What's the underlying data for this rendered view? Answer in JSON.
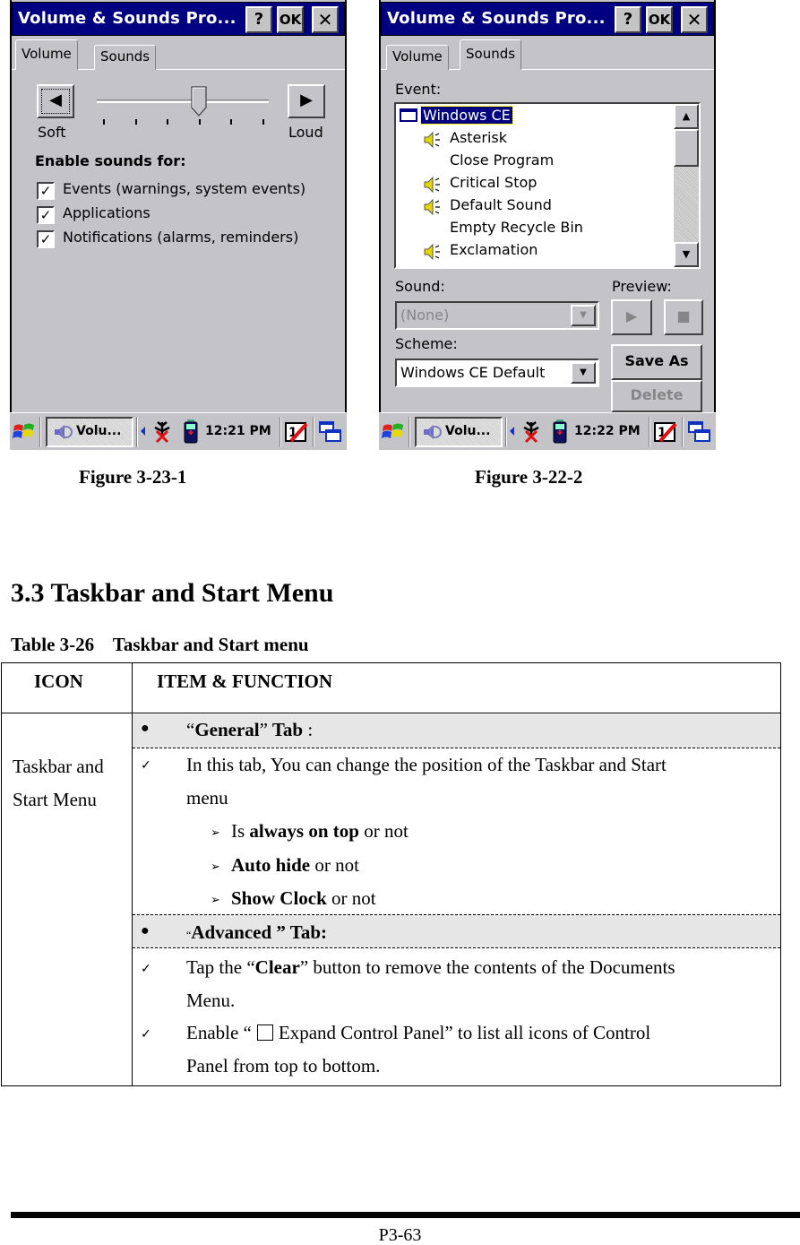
{
  "screenshots": {
    "volume": {
      "window_title": "Volume & Sounds Pro...",
      "title_buttons": {
        "help": "?",
        "ok": "OK",
        "close": "✕"
      },
      "tabs": [
        {
          "label": "Volume",
          "active": true
        },
        {
          "label": "Sounds",
          "active": false
        }
      ],
      "slider": {
        "min_label": "Soft",
        "max_label": "Loud",
        "value_fraction": 0.6,
        "tick_count": 6
      },
      "enable_heading": "Enable sounds for:",
      "checkboxes": [
        {
          "label": "Events (warnings, system events)",
          "checked": true
        },
        {
          "label": "Applications",
          "checked": true
        },
        {
          "label": "Notifications (alarms, reminders)",
          "checked": true
        }
      ],
      "taskbar": {
        "task_label": "Volu...",
        "clock": "12:21 PM",
        "input_indicator": "1"
      }
    },
    "sounds": {
      "window_title": "Volume & Sounds Pro...",
      "title_buttons": {
        "help": "?",
        "ok": "OK",
        "close": "✕"
      },
      "tabs": [
        {
          "label": "Volume",
          "active": false
        },
        {
          "label": "Sounds",
          "active": true
        }
      ],
      "event_label": "Event:",
      "event_root": "Windows CE",
      "events": [
        {
          "label": "Asterisk",
          "has_sound": true
        },
        {
          "label": "Close Program",
          "has_sound": false
        },
        {
          "label": "Critical Stop",
          "has_sound": true
        },
        {
          "label": "Default Sound",
          "has_sound": true
        },
        {
          "label": "Empty Recycle Bin",
          "has_sound": false
        },
        {
          "label": "Exclamation",
          "has_sound": true
        }
      ],
      "sound_label": "Sound:",
      "sound_value": "(None)",
      "preview_label": "Preview:",
      "scheme_label": "Scheme:",
      "scheme_value": "Windows CE Default",
      "save_as_label": "Save As",
      "delete_label": "Delete",
      "taskbar": {
        "task_label": "Volu...",
        "clock": "12:22 PM",
        "input_indicator": "1"
      }
    }
  },
  "captions": {
    "left": "Figure 3-23-1",
    "right": "Figure 3-22-2"
  },
  "section_heading": "3.3 Taskbar and Start Menu",
  "table_caption": "Table 3-26    Taskbar and Start menu",
  "table": {
    "headers": {
      "icon": "ICON",
      "item": "ITEM & FUNCTION"
    },
    "icon_cell": [
      "Taskbar and",
      "Start Menu"
    ],
    "general_tab": {
      "q_open": "“",
      "name": "General",
      "q_close": "”",
      "suffix": " Tab",
      "colon": " :"
    },
    "general_desc_line1": "In this tab, You can change the position of the Taskbar and Start",
    "general_desc_line2": "menu",
    "general_options": [
      {
        "pre": "Is ",
        "bold": "always on top",
        "post": " or not"
      },
      {
        "pre": "",
        "bold": "Auto hide",
        "post": " or not"
      },
      {
        "pre": "",
        "bold": "Show Clock",
        "post": " or not"
      }
    ],
    "advanced_tab": {
      "q_open": "“",
      "text": "Advanced ” Tab:"
    },
    "advanced_item1": {
      "pre": "Tap the “",
      "bold": "Clear",
      "post": "” button to remove the contents of the Documents",
      "line2": "Menu."
    },
    "advanced_item2": {
      "pre": "Enable   “",
      "label": "Expand Control Panel”",
      "post": "   to list all icons of Control",
      "line2": "Panel from top to bottom."
    }
  },
  "bullets": {
    "dot": "●",
    "check": "✓",
    "arrow": "➢"
  },
  "footer": {
    "page_number": "P3-63"
  }
}
